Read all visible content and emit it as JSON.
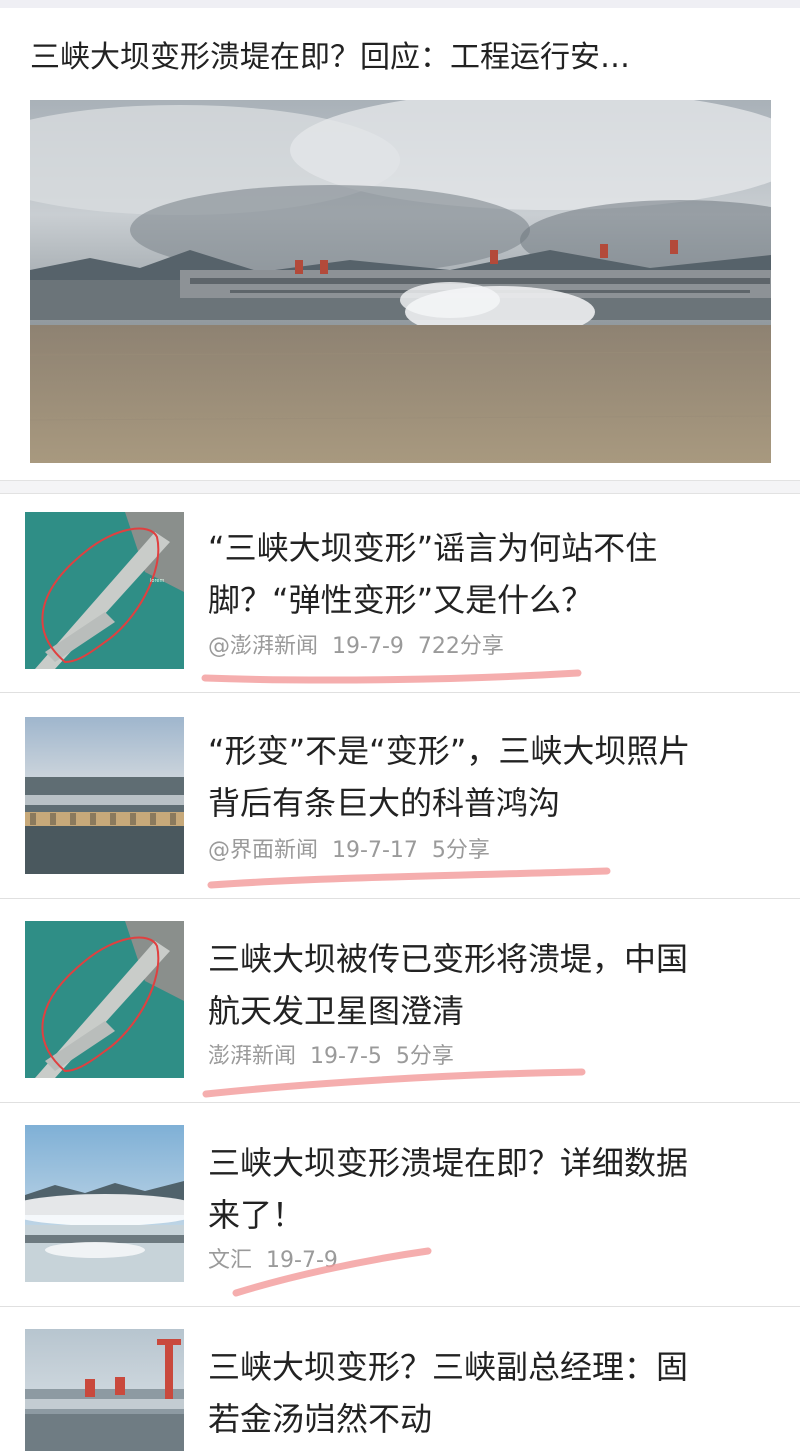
{
  "hero": {
    "title": "三峡大坝变形溃堤在即？回应：工程运行安…"
  },
  "articles": [
    {
      "line1": "“三峡大坝变形”谣言为何站不住",
      "line2": "脚？“弹性变形”又是什么？",
      "source": "@澎湃新闻",
      "date": "19-7-9",
      "shares": "722分享",
      "thumb": "satellite-dam-thumb"
    },
    {
      "line1": "“形变”不是“变形”，三峡大坝照片",
      "line2": "背后有条巨大的科普鸿沟",
      "source": "@界面新闻",
      "date": "19-7-17",
      "shares": "5分享",
      "thumb": "dam-panorama-thumb"
    },
    {
      "line1": "三峡大坝被传已变形将溃堤，中国",
      "line2": "航天发卫星图澄清",
      "source": "澎湃新闻",
      "date": "19-7-5",
      "shares": "5分享",
      "thumb": "satellite-dam-thumb"
    },
    {
      "line1": "三峡大坝变形溃堤在即？详细数据",
      "line2": "来了！",
      "source": "文汇",
      "date": "19-7-9",
      "shares": "",
      "thumb": "misty-dam-thumb"
    },
    {
      "line1": "三峡大坝变形？三峡副总经理：固",
      "line2": "若金汤岿然不动",
      "source": "",
      "date": "",
      "shares": "",
      "thumb": "crane-dam-thumb"
    }
  ],
  "colors": {
    "underline": "#f29a9a",
    "meta_text": "#9a9a9a",
    "title_text": "#222222"
  }
}
